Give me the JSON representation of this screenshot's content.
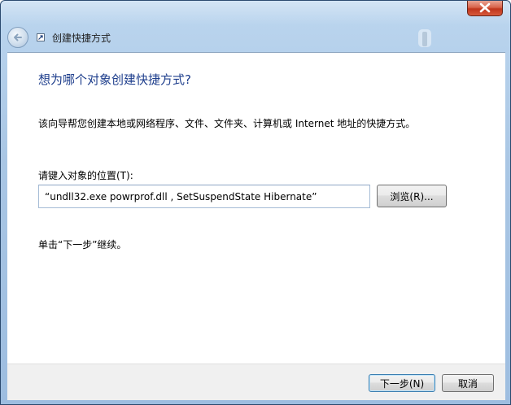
{
  "window": {
    "title": "创建快捷方式"
  },
  "page": {
    "heading": "想为哪个对象创建快捷方式?",
    "description": "该向导帮您创建本地或网络程序、文件、文件夹、计算机或 Internet 地址的快捷方式。",
    "location_label": "请键入对象的位置(T):",
    "location_value": "“undll32.exe powrprof.dll , SetSuspendState Hibernate”",
    "browse_label": "浏览(R)...",
    "hint": "单击“下一步”继续。"
  },
  "footer": {
    "next_label": "下一步(N)",
    "cancel_label": "取消"
  },
  "icons": {
    "close": "close-icon",
    "back": "back-arrow-icon",
    "shortcut": "shortcut-arrow-icon"
  },
  "colors": {
    "heading": "#1e3e8c",
    "titlebar": "#a9c6e4",
    "close_button": "#c0351c"
  }
}
